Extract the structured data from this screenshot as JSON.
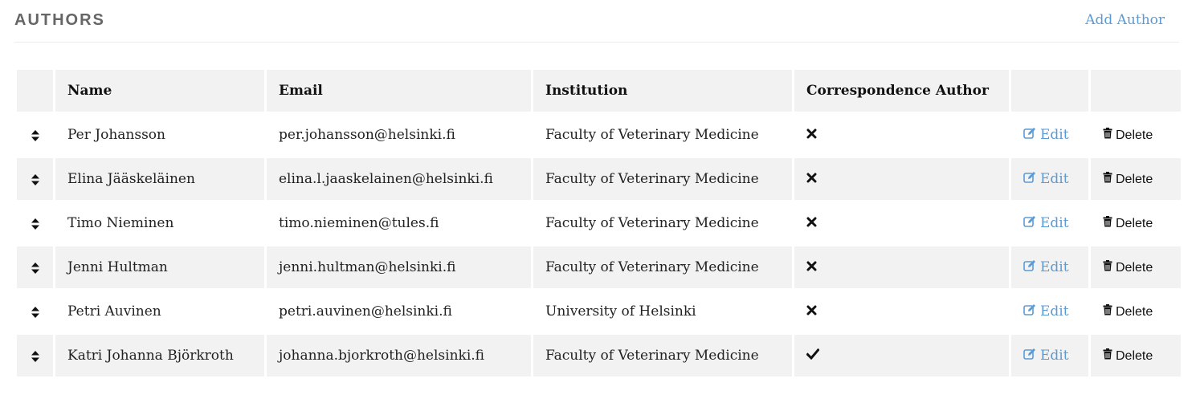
{
  "header": {
    "title": "AUTHORS",
    "add_label": "Add Author"
  },
  "table": {
    "columns": [
      "",
      "Name",
      "Email",
      "Institution",
      "Correspondence Author",
      "",
      ""
    ],
    "edit_label": "Edit",
    "delete_label": "Delete",
    "rows": [
      {
        "name": "Per Johansson",
        "email": "per.johansson@helsinki.fi",
        "institution": "Faculty of Veterinary Medicine",
        "correspondence": false
      },
      {
        "name": "Elina Jääskeläinen",
        "email": "elina.l.jaaskelainen@helsinki.fi",
        "institution": "Faculty of Veterinary Medicine",
        "correspondence": false
      },
      {
        "name": "Timo Nieminen",
        "email": "timo.nieminen@tules.fi",
        "institution": "Faculty of Veterinary Medicine",
        "correspondence": false
      },
      {
        "name": "Jenni Hultman",
        "email": "jenni.hultman@helsinki.fi",
        "institution": "Faculty of Veterinary Medicine",
        "correspondence": false
      },
      {
        "name": "Petri Auvinen",
        "email": "petri.auvinen@helsinki.fi",
        "institution": "University of Helsinki",
        "correspondence": false
      },
      {
        "name": "Katri Johanna Björkroth",
        "email": "johanna.bjorkroth@helsinki.fi",
        "institution": "Faculty of Veterinary Medicine",
        "correspondence": true
      }
    ]
  },
  "icons": {
    "sort": "sort-icon",
    "yes": "check-icon",
    "no": "x-icon",
    "edit": "edit-icon",
    "delete": "trash-icon"
  },
  "colors": {
    "link": "#5b9bd5",
    "stripe": "#f2f2f2",
    "title": "#666666"
  }
}
